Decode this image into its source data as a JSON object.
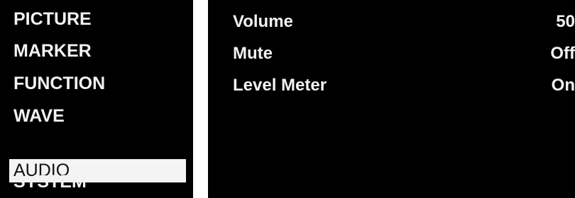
{
  "menu": {
    "items": [
      {
        "label": "PICTURE",
        "selected": false
      },
      {
        "label": "MARKER",
        "selected": false
      },
      {
        "label": "FUNCTION",
        "selected": false
      },
      {
        "label": "WAVE",
        "selected": false
      },
      {
        "label": "AUDIO",
        "selected": true
      },
      {
        "label": "SYSTEM",
        "selected": false
      }
    ]
  },
  "settings": {
    "rows": [
      {
        "label": "Volume",
        "value": "50"
      },
      {
        "label": "Mute",
        "value": "Off"
      },
      {
        "label": "Level Meter",
        "value": "On"
      }
    ]
  },
  "colors": {
    "background": "#000000",
    "text": "#f2f2f2",
    "selection_highlight": "#f4f4f4",
    "selected_text": "#111111"
  }
}
